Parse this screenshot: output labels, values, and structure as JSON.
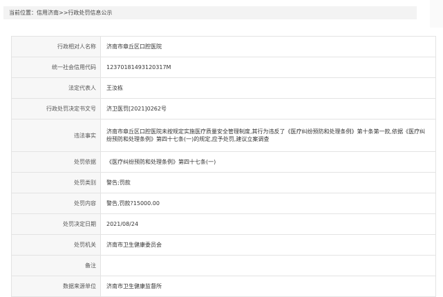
{
  "breadcrumb": {
    "text": "当前位置：信用济南>>行政处罚信息公示"
  },
  "details": {
    "rows": [
      {
        "label": "行政相对人名称",
        "value": "济南市章丘区口腔医院"
      },
      {
        "label": "统一社会信用代码",
        "value": "12370181493120317M"
      },
      {
        "label": "法定代表人",
        "value": "王汝栋"
      },
      {
        "label": "行政处罚决定书文号",
        "value": "济卫医罚[2021]0262号"
      },
      {
        "label": "违法事实",
        "value": "济南市章丘区口腔医院未按规定实施医疗质量安全管理制度,其行为违反了《医疗纠纷预防和处理条例》第十条第一款,依据《医疗纠纷预防和处理条例》第四十七条(一)的规定,应予处罚,建议立案调查"
      },
      {
        "label": "处罚依据",
        "value": "《医疗纠纷预防和处理条例》第四十七条(一)"
      },
      {
        "label": "处罚类别",
        "value": "警告;罚款"
      },
      {
        "label": "处罚内容",
        "value": "警告,罚款?15000.00"
      },
      {
        "label": "处罚决定日期",
        "value": "2021/08/24"
      },
      {
        "label": "处罚机关",
        "value": "济南市卫生健康委员会"
      },
      {
        "label": "备注",
        "value": ""
      },
      {
        "label": "数据来源单位",
        "value": "济南市卫生健康监督所"
      }
    ]
  }
}
